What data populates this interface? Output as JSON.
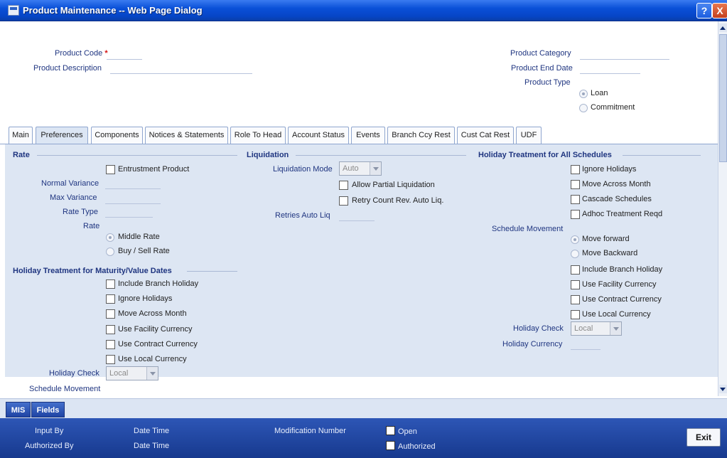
{
  "window": {
    "title": "Product Maintenance -- Web Page Dialog",
    "help_label": "?",
    "close_label": "X"
  },
  "header": {
    "product_code_label": "Product Code",
    "required_mark": "*",
    "product_description_label": "Product Description",
    "product_category_label": "Product Category",
    "product_end_date_label": "Product End Date",
    "product_type_label": "Product Type",
    "product_type_options": [
      "Loan",
      "Commitment"
    ],
    "product_type_selected": "Loan"
  },
  "tabs": [
    "Main",
    "Preferences",
    "Components",
    "Notices & Statements",
    "Role To Head",
    "Account Status",
    "Events",
    "Branch Ccy Rest",
    "Cust Cat Rest",
    "UDF"
  ],
  "active_tab": "Preferences",
  "rate": {
    "section_title": "Rate",
    "entrustment_label": "Entrustment Product",
    "normal_variance_label": "Normal Variance",
    "max_variance_label": "Max Variance",
    "rate_type_label": "Rate Type",
    "rate_label": "Rate",
    "rate_options": [
      "Middle Rate",
      "Buy / Sell Rate"
    ],
    "rate_selected": "Middle Rate"
  },
  "liquidation": {
    "section_title": "Liquidation",
    "mode_label": "Liquidation Mode",
    "mode_value": "Auto",
    "allow_partial_label": "Allow Partial Liquidation",
    "retry_count_label": "Retry Count Rev. Auto Liq.",
    "retries_auto_liq_label": "Retries Auto Liq"
  },
  "holiday_all": {
    "section_title": "Holiday Treatment for All Schedules",
    "ignore_holidays": "Ignore Holidays",
    "move_across_month": "Move Across Month",
    "cascade_schedules": "Cascade Schedules",
    "adhoc_treatment": "Adhoc Treatment Reqd",
    "schedule_movement_label": "Schedule Movement",
    "movement_options": [
      "Move forward",
      "Move Backward"
    ],
    "movement_selected": "Move forward",
    "include_branch_holiday": "Include Branch Holiday",
    "use_facility_currency": "Use Facility Currency",
    "use_contract_currency": "Use Contract Currency",
    "use_local_currency": "Use Local Currency",
    "holiday_check_label": "Holiday Check",
    "holiday_check_value": "Local",
    "holiday_currency_label": "Holiday Currency"
  },
  "holiday_maturity": {
    "section_title": "Holiday Treatment for Maturity/Value Dates",
    "include_branch_holiday": "Include Branch Holiday",
    "ignore_holidays": "Ignore Holidays",
    "move_across_month": "Move Across Month",
    "use_facility_currency": "Use Facility Currency",
    "use_contract_currency": "Use Contract Currency",
    "use_local_currency": "Use Local Currency",
    "holiday_check_label": "Holiday Check",
    "holiday_check_value": "Local",
    "schedule_movement_label": "Schedule Movement"
  },
  "bottom_tabs": [
    "MIS",
    "Fields"
  ],
  "footer": {
    "input_by": "Input By",
    "date_time_1": "Date Time",
    "modification_number": "Modification Number",
    "open": "Open",
    "authorized_by": "Authorized By",
    "date_time_2": "Date Time",
    "authorized": "Authorized",
    "exit": "Exit"
  }
}
